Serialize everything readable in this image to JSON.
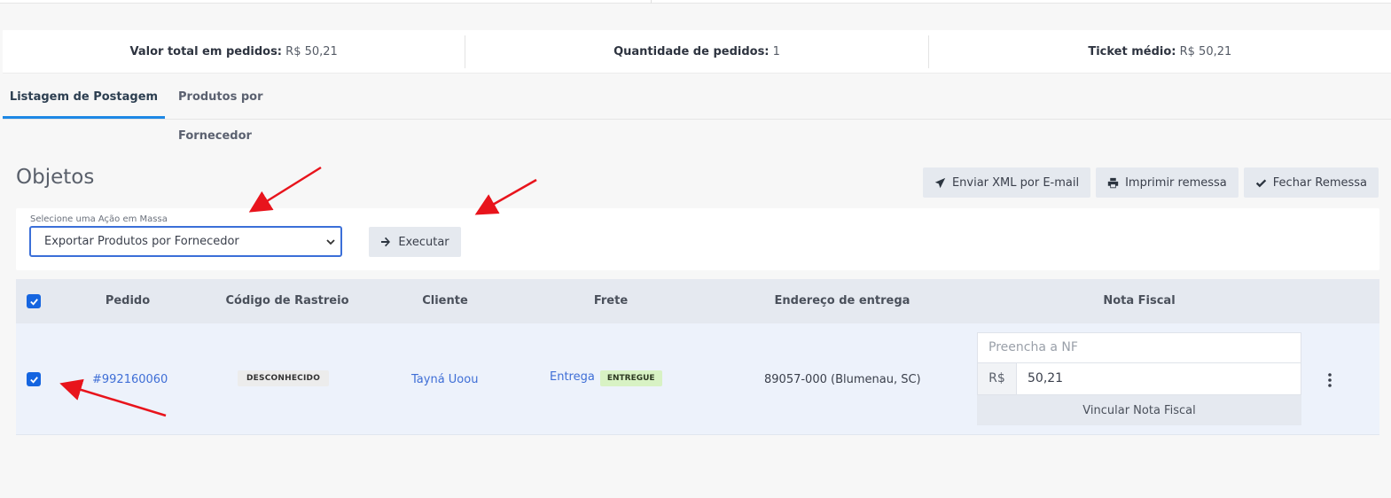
{
  "stats": {
    "total_label": "Valor total em pedidos:",
    "total_value": "R$ 50,21",
    "qty_label": "Quantidade de pedidos:",
    "qty_value": "1",
    "ticket_label": "Ticket médio:",
    "ticket_value": "R$ 50,21"
  },
  "tabs": [
    {
      "label": "Listagem de Postagem",
      "active": true
    },
    {
      "label": "Produtos por Fornecedor",
      "active": false
    }
  ],
  "section": {
    "title": "Objetos"
  },
  "toolbar": {
    "send_xml": "Enviar XML por E-mail",
    "print": "Imprimir remessa",
    "close": "Fechar Remessa"
  },
  "mass_action": {
    "label": "Selecione uma Ação em Massa",
    "selected": "Exportar Produtos por Fornecedor",
    "execute": "Executar"
  },
  "table": {
    "columns": [
      "Pedido",
      "Código de Rastreio",
      "Cliente",
      "Frete",
      "Endereço de entrega",
      "Nota Fiscal"
    ],
    "rows": [
      {
        "order": "#992160060",
        "tracking": "DESCONHECIDO",
        "client": "Tayná Uoou",
        "shipping": "Entrega",
        "shipping_status": "ENTREGUE",
        "address": "89057-000 (Blumenau, SC)",
        "nf_placeholder": "Preencha a NF",
        "currency": "R$",
        "amount": "50,21",
        "link_nf": "Vincular Nota Fiscal"
      }
    ]
  },
  "colors": {
    "accent": "#1e88e5",
    "checkbox": "#1565e0",
    "link": "#3e6ed6",
    "annotation_arrow": "#e8141c"
  },
  "icons": [
    "send-icon",
    "print-icon",
    "check-icon",
    "arrow-right-icon",
    "chevron-down-icon",
    "kebab-menu-icon"
  ]
}
